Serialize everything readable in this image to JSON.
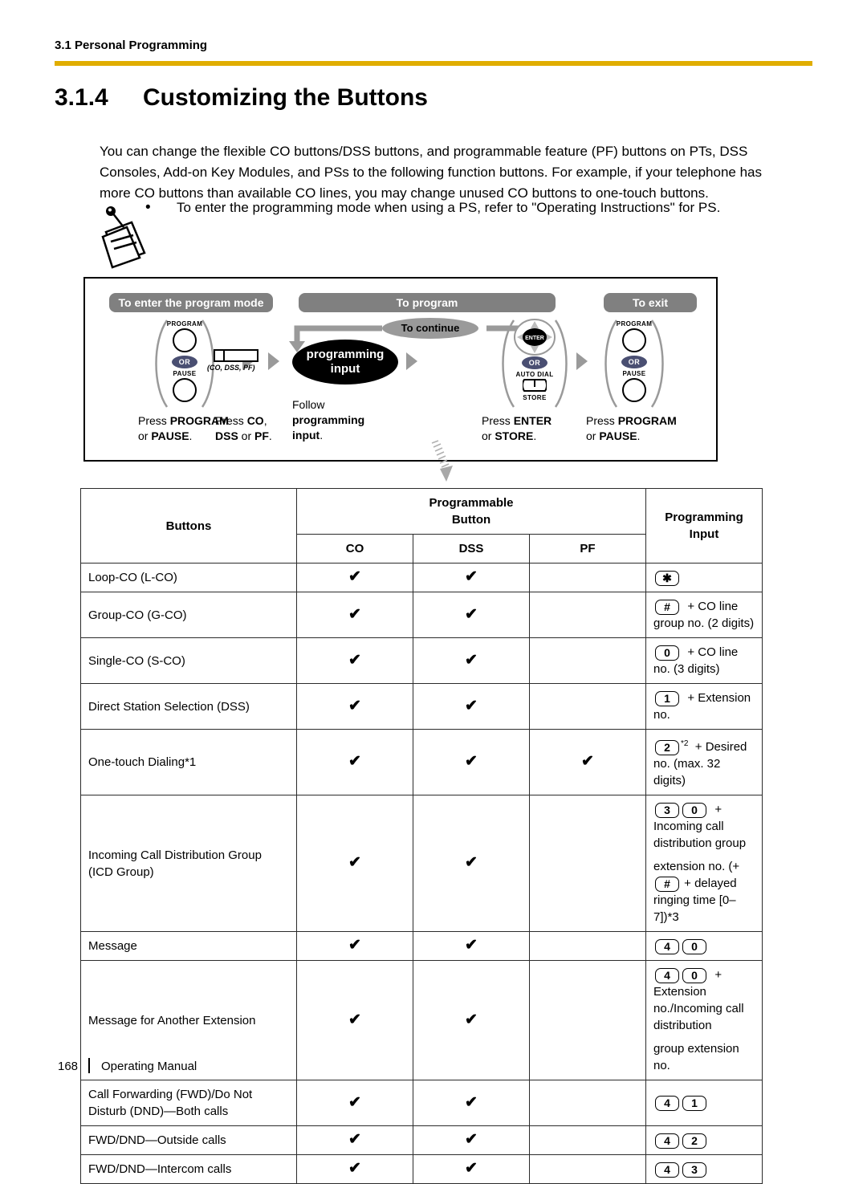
{
  "header": {
    "running_head": "3.1 Personal Programming",
    "rule_color": "#E0AD00"
  },
  "section": {
    "number": "3.1.4",
    "title": "Customizing the Buttons"
  },
  "intro": "You can change the flexible CO buttons/DSS buttons, and programmable feature (PF) buttons on PTs, DSS Consoles, Add-on Key Modules, and PSs to the following function buttons. For example, if your telephone has more CO buttons than available CO lines, you may change unused CO buttons to one-touch buttons.",
  "note": {
    "bullet": "•",
    "text": "To enter the programming mode when using a PS, refer to \"Operating Instructions\" for PS."
  },
  "flow": {
    "pill_enter": "To enter the program mode",
    "pill_program": "To program",
    "pill_exit": "To exit",
    "continue_label": "To continue",
    "programming_input_line1": "programming",
    "programming_input_line2": "input",
    "co_button_label": "(CO, DSS, PF)",
    "keys": {
      "program": "PROGRAM",
      "pause": "PAUSE",
      "or": "OR",
      "enter": "ENTER",
      "auto_dial": "AUTO DIAL",
      "store": "STORE"
    },
    "captions": [
      {
        "l1a": "Press ",
        "l1b": "PROGRAM",
        "l2a": "or ",
        "l2b": "PAUSE",
        "l2c": "."
      },
      {
        "l1a": "Press ",
        "l1b": "CO",
        "l1c": ",",
        "l2a": "",
        "l2b": "DSS",
        "l2c": " or ",
        "l2d": "PF",
        "l2e": "."
      },
      {
        "l1a": "Follow",
        "l2b": "programming",
        "l3a": "input",
        "l3b": "."
      },
      {
        "l1a": "Press ",
        "l1b": "ENTER",
        "l2a": "or ",
        "l2b": "STORE",
        "l2c": "."
      },
      {
        "l1a": "Press ",
        "l1b": "PROGRAM",
        "l2a": "or ",
        "l2b": "PAUSE",
        "l2c": "."
      }
    ]
  },
  "table": {
    "headers": {
      "buttons": "Buttons",
      "programmable_button": "Programmable\nButton",
      "co": "CO",
      "dss": "DSS",
      "pf": "PF",
      "programming_input": "Programming Input"
    },
    "check_glyph": "✔",
    "rows": [
      {
        "button": "Loop-CO (L-CO)",
        "co": true,
        "dss": true,
        "pf": false,
        "input_keys": [
          "✱"
        ],
        "input_text": ""
      },
      {
        "button": "Group-CO (G-CO)",
        "co": true,
        "dss": true,
        "pf": false,
        "input_keys": [
          "#"
        ],
        "input_text": "+ CO line group no. (2 digits)"
      },
      {
        "button": "Single-CO (S-CO)",
        "co": true,
        "dss": true,
        "pf": false,
        "input_keys": [
          "0"
        ],
        "input_text": "+ CO line no. (3 digits)"
      },
      {
        "button": "Direct Station Selection (DSS)",
        "co": true,
        "dss": true,
        "pf": false,
        "input_keys": [
          "1"
        ],
        "input_text": "+ Extension no."
      },
      {
        "button": "One-touch Dialing*1",
        "co": true,
        "dss": true,
        "pf": true,
        "input_keys": [
          "2"
        ],
        "input_sup": "*2",
        "input_text": "+ Desired no. (max. 32 digits)"
      },
      {
        "button": "Incoming Call Distribution Group (ICD Group)",
        "co": true,
        "dss": true,
        "pf": false,
        "input_keys": [
          "3",
          "0"
        ],
        "input_text": "+ Incoming call distribution group",
        "input_line2_pre": "extension no. (+",
        "input_line2_key": "#",
        "input_line2_post": "+ delayed ringing time [0–7])*3"
      },
      {
        "button": "Message",
        "co": true,
        "dss": true,
        "pf": false,
        "input_keys": [
          "4",
          "0"
        ],
        "input_text": ""
      },
      {
        "button": "Message for Another Extension",
        "co": true,
        "dss": true,
        "pf": false,
        "input_keys": [
          "4",
          "0"
        ],
        "input_text": "+ Extension no./Incoming call distribution",
        "input_line2_pre": "group extension no."
      },
      {
        "button": "Call Forwarding (FWD)/Do Not Disturb (DND)—Both calls",
        "co": true,
        "dss": true,
        "pf": false,
        "input_keys": [
          "4",
          "1"
        ],
        "input_text": ""
      },
      {
        "button": "FWD/DND—Outside calls",
        "co": true,
        "dss": true,
        "pf": false,
        "input_keys": [
          "4",
          "2"
        ],
        "input_text": ""
      },
      {
        "button": "FWD/DND—Intercom calls",
        "co": true,
        "dss": true,
        "pf": false,
        "input_keys": [
          "4",
          "3"
        ],
        "input_text": ""
      }
    ]
  },
  "footer": {
    "page_number": "168",
    "doc_title": "Operating Manual"
  }
}
